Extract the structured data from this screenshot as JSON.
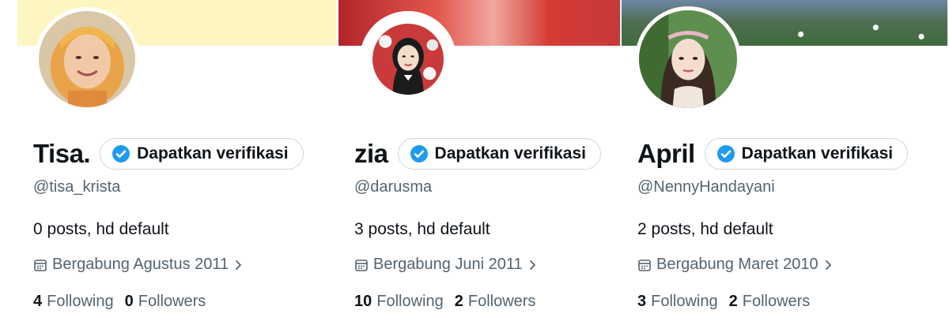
{
  "profiles": [
    {
      "display_name": "Tisa.",
      "verify_label": "Dapatkan verifikasi",
      "handle": "@tisa_krista",
      "bio": "0 posts, hd default",
      "joined": "Bergabung Agustus 2011",
      "following_count": "4",
      "following_label": "Following",
      "followers_count": "0",
      "followers_label": "Followers"
    },
    {
      "display_name": "zia",
      "verify_label": "Dapatkan verifikasi",
      "handle": "@darusma",
      "bio": "3 posts, hd default",
      "joined": "Bergabung Juni 2011",
      "following_count": "10",
      "following_label": "Following",
      "followers_count": "2",
      "followers_label": "Followers"
    },
    {
      "display_name": "April",
      "verify_label": "Dapatkan verifikasi",
      "handle": "@NennyHandayani",
      "bio": "2 posts, hd default",
      "joined": "Bergabung Maret 2010",
      "following_count": "3",
      "following_label": "Following",
      "followers_count": "2",
      "followers_label": "Followers"
    }
  ],
  "icons": {
    "verify": "verified-badge-icon",
    "joined": "calendar-icon",
    "chevron": "chevron-right-icon"
  },
  "colors": {
    "verified_blue": "#1d9bf0",
    "text_primary": "#0f1419",
    "text_secondary": "#536471",
    "border": "#cfd9de",
    "banner_1": "#fdf6c3"
  }
}
